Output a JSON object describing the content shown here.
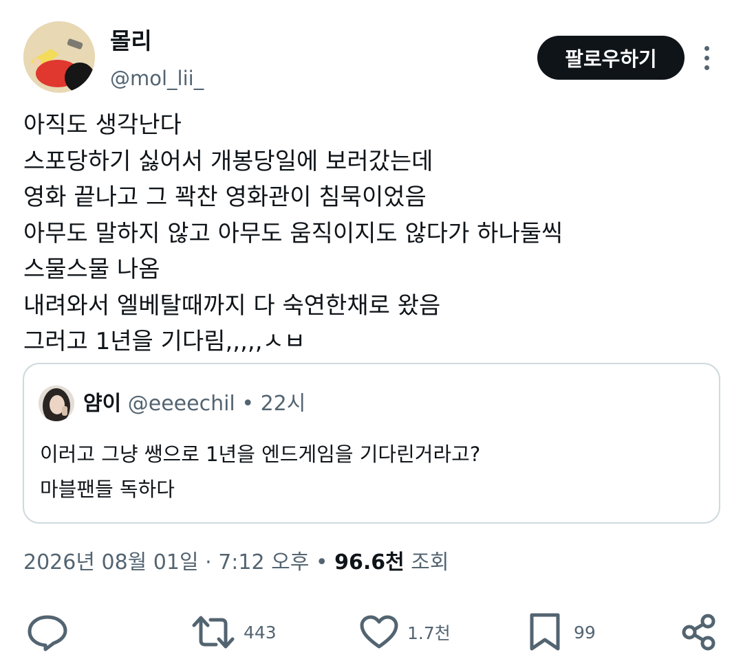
{
  "author": {
    "display_name": "몰리",
    "handle": "@mol_lii_",
    "follow_label": "팔로우하기"
  },
  "tweet": {
    "lines": [
      "아직도 생각난다",
      "스포당하기 싫어서 개봉당일에 보러갔는데",
      "영화 끝나고 그 꽉찬 영화관이 침묵이었음",
      "아무도 말하지 않고 아무도 움직이지도 않다가 하나둘씩",
      "스물스물 나옴",
      "내려와서 엘베탈때까지 다 숙연한채로 왔음",
      "그러고 1년을 기다림,,,,,ㅅㅂ"
    ]
  },
  "quote": {
    "display_name": "얌이",
    "handle": "@eeeechil",
    "separator": "•",
    "time": "22시",
    "lines": [
      "이러고 그냥 쌩으로 1년을 엔드게임을 기다린거라고?",
      "마블팬들 독하다"
    ]
  },
  "meta": {
    "date": "2026년 08월 01일",
    "sep1": "·",
    "time": "7:12 오후",
    "sep2": "•",
    "views_count": "96.6천",
    "views_label": "조회"
  },
  "actions": {
    "reply_count": "",
    "retweet_count": "443",
    "like_count": "1.7천",
    "bookmark_count": "99"
  },
  "icons": {
    "reply": "speech-bubble-icon",
    "retweet": "retweet-arrows-icon",
    "like": "heart-icon",
    "bookmark": "bookmark-icon",
    "share": "share-nodes-icon",
    "more": "vertical-dots-icon"
  },
  "colors": {
    "text": "#0f1419",
    "muted": "#536471",
    "border": "#cfd9de",
    "button_bg": "#0f1419"
  }
}
